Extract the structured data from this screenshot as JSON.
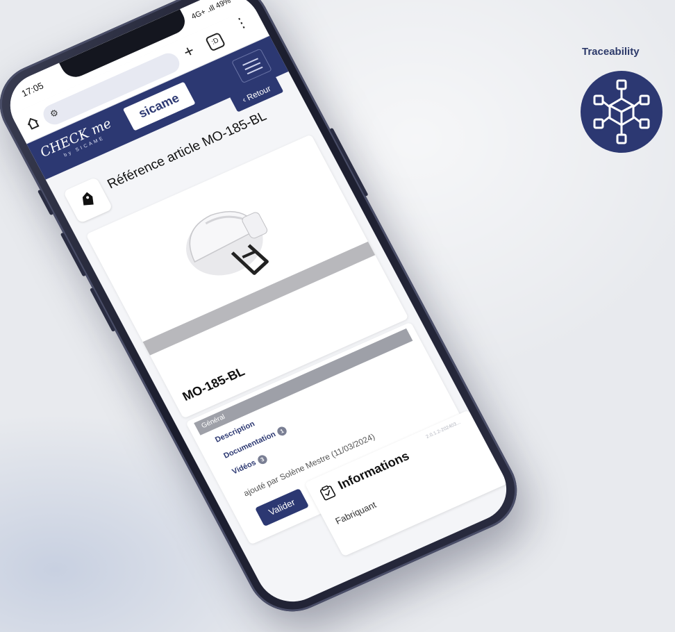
{
  "badge_top_right": {
    "label": "Traceability",
    "icon": "network-nodes-icon",
    "color": "#2c3872"
  },
  "phone": {
    "status": {
      "time": "17:05",
      "indicators": "4G+ .ıll 49%"
    },
    "browser": {
      "home_icon": "home-icon",
      "url_icon": "site-settings-icon",
      "new_tab": "+",
      "tab_count": ":D",
      "more": "⋮"
    },
    "app": {
      "brand": "CHECK me",
      "brand_sub": "by SICAME",
      "partner_logo": "sicame",
      "menu_icon": "hamburger-icon",
      "accent_color": "#2c3872"
    },
    "page": {
      "title": "Référence article MO-185-BL",
      "back_label": "Retour",
      "product_code": "MO-185-BL",
      "product_image": "white-safety-helmet-with-visor",
      "tab_section_label": "Général",
      "tabs": [
        {
          "label": "Description",
          "count": ""
        },
        {
          "label": "Documentation",
          "count": "1"
        },
        {
          "label": "Vidéos",
          "count": "3"
        }
      ],
      "added_by": "ajouté par Solène Mestre (11/03/2024)",
      "validate_label": "Valider",
      "info_title": "Informations",
      "info_field": "Fabriquant",
      "version": "2.0.1.2-202403..."
    }
  }
}
